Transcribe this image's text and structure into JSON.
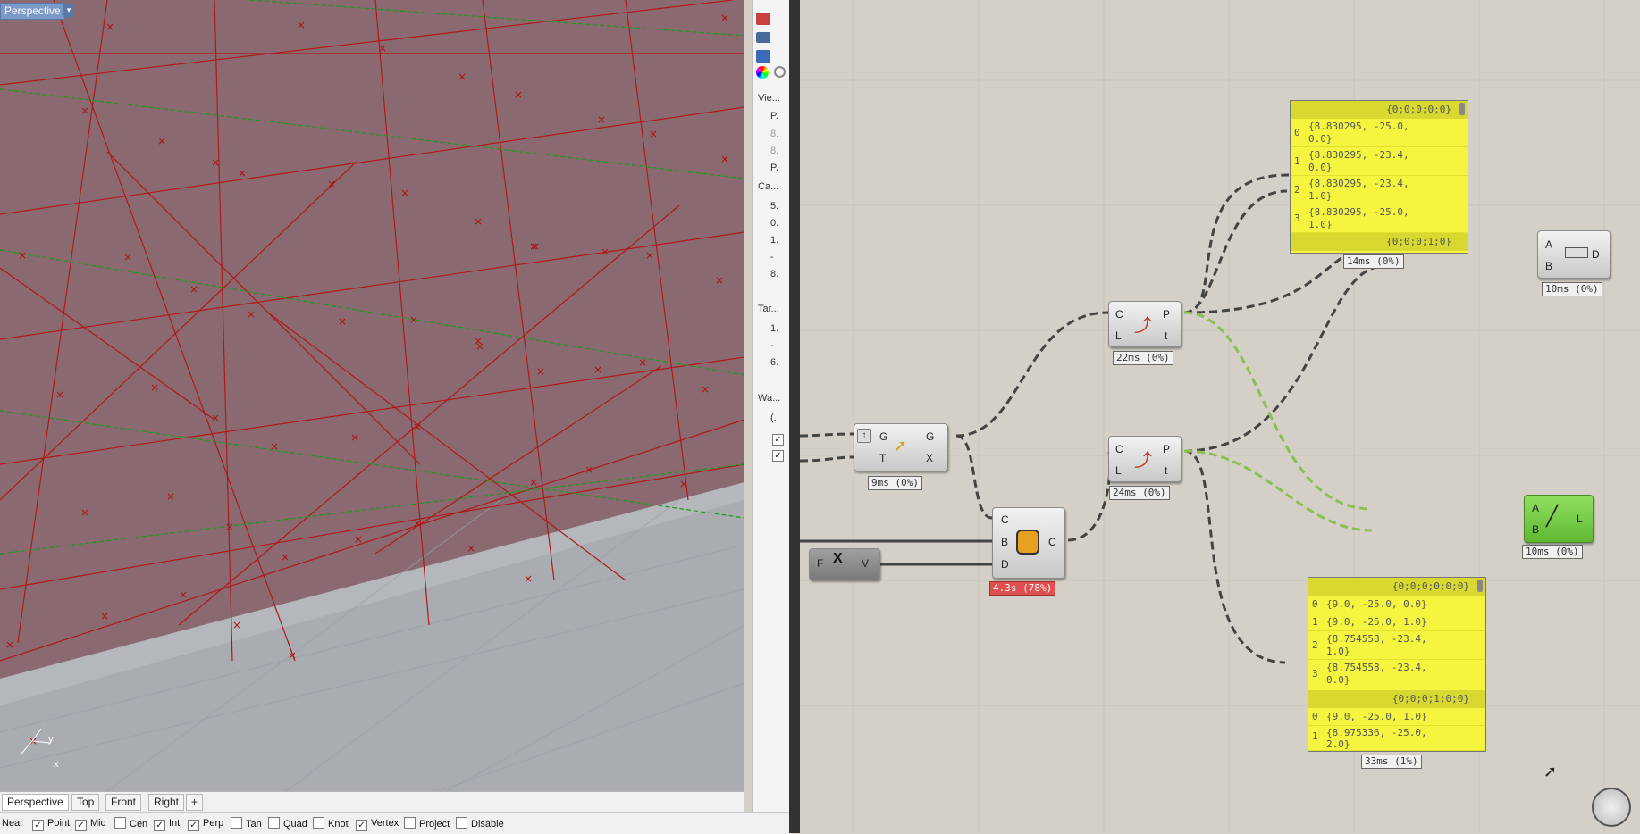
{
  "viewport": {
    "label": "Perspective",
    "dropdown": "▾",
    "axis_x": "x",
    "axis_y": "y",
    "tabs": [
      "Perspective",
      "Top",
      "Front",
      "Right",
      "+"
    ]
  },
  "osnap": [
    {
      "label": "Near",
      "checked": false
    },
    {
      "label": "Point",
      "checked": true
    },
    {
      "label": "Mid",
      "checked": true
    },
    {
      "label": "Cen",
      "checked": false
    },
    {
      "label": "Int",
      "checked": true
    },
    {
      "label": "Perp",
      "checked": true
    },
    {
      "label": "Tan",
      "checked": false
    },
    {
      "label": "Quad",
      "checked": false
    },
    {
      "label": "Knot",
      "checked": false
    },
    {
      "label": "Vertex",
      "checked": true
    },
    {
      "label": "Project",
      "checked": false
    },
    {
      "label": "Disable",
      "checked": false
    }
  ],
  "properties": {
    "section_view": "Vie...",
    "section_camera": "Ca...",
    "section_target": "Tar...",
    "section_wallpaper": "Wa...",
    "items": [
      "P.",
      "8.",
      "8.",
      "P.",
      "5.",
      "0.",
      "1.",
      "-",
      "8.",
      "1.",
      "-",
      "6.",
      "(."
    ]
  },
  "gh": {
    "panel_top": {
      "header": "{0;0;0;0;0}",
      "footer": "{0;0;0;1;0}",
      "rows": [
        {
          "i": "0",
          "v": "{8.830295, -25.0,",
          "v2": "0.0}"
        },
        {
          "i": "1",
          "v": "{8.830295, -23.4,",
          "v2": "0.0}"
        },
        {
          "i": "2",
          "v": "{8.830295, -23.4,",
          "v2": "1.0}"
        },
        {
          "i": "3",
          "v": "{8.830295, -25.0,",
          "v2": "1.0}"
        }
      ],
      "time": "14ms (0%)"
    },
    "panel_bottom": {
      "header": "{0;0;0;0;0;0}",
      "header2": "{0;0;0;1;0;0}",
      "rows": [
        {
          "i": "0",
          "v": "{9.0, -25.0, 0.0}",
          "v2": ""
        },
        {
          "i": "1",
          "v": "{9.0, -25.0, 1.0}",
          "v2": ""
        },
        {
          "i": "2",
          "v": "{8.754558, -23.4,",
          "v2": "1.0}"
        },
        {
          "i": "3",
          "v": "{8.754558, -23.4,",
          "v2": "0.0}"
        }
      ],
      "rows2": [
        {
          "i": "0",
          "v": "{9.0, -25.0, 1.0}",
          "v2": ""
        },
        {
          "i": "1",
          "v": "{8.975336, -25.0,",
          "v2": "2.0}"
        }
      ],
      "time": "33ms (1%)"
    },
    "distance": {
      "a": "A",
      "b": "B",
      "d": "D",
      "time": "10ms (0%)"
    },
    "cp1": {
      "c": "C",
      "l": "L",
      "p": "P",
      "t": "t",
      "time": "22ms (0%)"
    },
    "cp2": {
      "c": "C",
      "l": "L",
      "p": "P",
      "t": "t",
      "time": "24ms (0%)"
    },
    "move": {
      "g": "G",
      "t": "T",
      "g2": "G",
      "x": "X",
      "time": "9ms (0%)"
    },
    "boolean": {
      "c": "C",
      "b": "B",
      "d": "D",
      "c2": "C",
      "time": "4.3s (78%)"
    },
    "expr": {
      "f": "F",
      "v": "V"
    },
    "line": {
      "a": "A",
      "b": "B",
      "l": "L",
      "time": "10ms (0%)"
    }
  },
  "colors": {
    "viewport_bg": "#8a6a70",
    "curve": "#c81e1e",
    "green": "#1e9a1e",
    "panel": "#f5f540",
    "error": "#e05050",
    "line_comp": "#6cc83a"
  }
}
